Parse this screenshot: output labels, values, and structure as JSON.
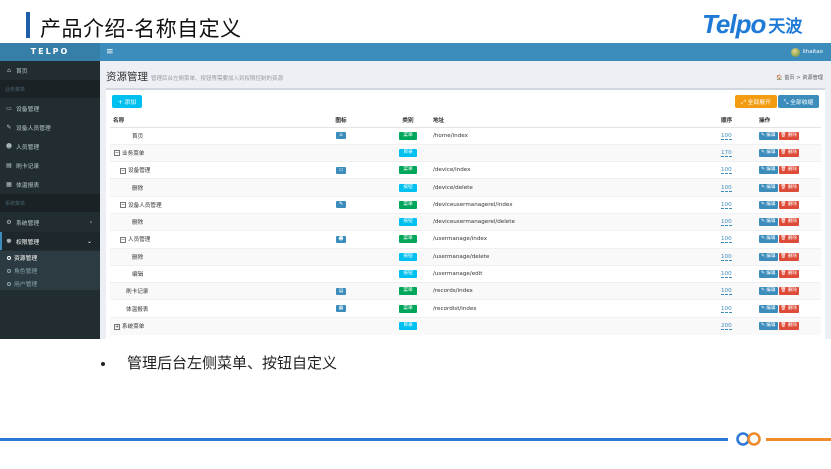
{
  "slide": {
    "title": "产品介绍-名称自定义",
    "logo_en": "Telpo",
    "logo_cn": "天波",
    "bullet": "管理后台左侧菜单、按钮自定义"
  },
  "app": {
    "brand": "TELPO",
    "menu_toggle": "≡",
    "user_name": "lihaitao",
    "page_title": "资源管理",
    "page_subtitle": "管理后台左侧菜单、按钮等需要加入到权限控制的资源",
    "breadcrumb": "🏠 首页  >  资源管理",
    "buttons": {
      "add": "+ 添加",
      "expand_all": "⤢ 全部展开",
      "collapse_all": "⤡ 全部收缩"
    },
    "sidebar": [
      {
        "label": "首页",
        "icon": "home-icon",
        "glyph": "⌂",
        "type": "item"
      },
      {
        "label": "业务菜单",
        "type": "header"
      },
      {
        "label": "设备管理",
        "icon": "monitor-icon",
        "glyph": "▭",
        "type": "item"
      },
      {
        "label": "设备人员管理",
        "icon": "wrench-icon",
        "glyph": "✎",
        "type": "item"
      },
      {
        "label": "人员管理",
        "icon": "users-icon",
        "glyph": "☻",
        "type": "item"
      },
      {
        "label": "刷卡记录",
        "icon": "card-icon",
        "glyph": "▤",
        "type": "item"
      },
      {
        "label": "体温报表",
        "icon": "table-icon",
        "glyph": "▦",
        "type": "item"
      },
      {
        "label": "系统菜单",
        "type": "header"
      },
      {
        "label": "系统管理",
        "icon": "cogs-icon",
        "glyph": "⚙",
        "type": "item",
        "chevron": "‹"
      },
      {
        "label": "权限管理",
        "icon": "permission-icon",
        "glyph": "☸",
        "type": "open",
        "chevron": "⌄"
      }
    ],
    "sidebar_sub": [
      {
        "label": "资源管理",
        "active": true
      },
      {
        "label": "角色管理",
        "active": false
      },
      {
        "label": "用户管理",
        "active": false
      }
    ],
    "table": {
      "headers": [
        "名称",
        "图标",
        "类别",
        "地址",
        "顺序",
        "操作"
      ],
      "edit_label": "✎ 编辑",
      "delete_label": "🗑 删除",
      "rows": [
        {
          "name": "首页",
          "indent": 3,
          "toggle": "",
          "icon": "⌂",
          "icon_name": "home-icon",
          "type": "菜单",
          "kind": "menu",
          "url": "/home/index",
          "order": "100"
        },
        {
          "name": "业务菜单",
          "indent": 0,
          "toggle": "−",
          "icon": "",
          "icon_name": "",
          "type": "目录",
          "kind": "dir",
          "url": "",
          "order": "170"
        },
        {
          "name": "设备管理",
          "indent": 1,
          "toggle": "−",
          "icon": "▭",
          "icon_name": "monitor-icon",
          "type": "菜单",
          "kind": "menu",
          "url": "/device/index",
          "order": "100"
        },
        {
          "name": "删除",
          "indent": 3,
          "toggle": "",
          "icon": "",
          "icon_name": "",
          "type": "按钮",
          "kind": "btn",
          "url": "/device/delete",
          "order": "100"
        },
        {
          "name": "设备人员管理",
          "indent": 1,
          "toggle": "−",
          "icon": "✎",
          "icon_name": "wrench-icon",
          "type": "菜单",
          "kind": "menu",
          "url": "/deviceusermanagerel/index",
          "order": "100"
        },
        {
          "name": "删除",
          "indent": 3,
          "toggle": "",
          "icon": "",
          "icon_name": "",
          "type": "按钮",
          "kind": "btn",
          "url": "/deviceusermanagerel/delete",
          "order": "100"
        },
        {
          "name": "人员管理",
          "indent": 1,
          "toggle": "−",
          "icon": "☻",
          "icon_name": "users-icon",
          "type": "菜单",
          "kind": "menu",
          "url": "/usermanage/index",
          "order": "100"
        },
        {
          "name": "删除",
          "indent": 3,
          "toggle": "",
          "icon": "",
          "icon_name": "",
          "type": "按钮",
          "kind": "btn",
          "url": "/usermanage/delete",
          "order": "100"
        },
        {
          "name": "编辑",
          "indent": 3,
          "toggle": "",
          "icon": "",
          "icon_name": "",
          "type": "按钮",
          "kind": "btn",
          "url": "/usermanage/edit",
          "order": "100"
        },
        {
          "name": "刷卡记录",
          "indent": 2,
          "toggle": "",
          "icon": "▤",
          "icon_name": "card-icon",
          "type": "菜单",
          "kind": "menu",
          "url": "/records/index",
          "order": "100"
        },
        {
          "name": "体温报表",
          "indent": 2,
          "toggle": "",
          "icon": "▦",
          "icon_name": "table-icon",
          "type": "菜单",
          "kind": "menu",
          "url": "/recordist/index",
          "order": "100"
        },
        {
          "name": "系统菜单",
          "indent": 0,
          "toggle": "+",
          "icon": "",
          "icon_name": "",
          "type": "目录",
          "kind": "dir",
          "url": "",
          "order": "200"
        }
      ]
    }
  }
}
